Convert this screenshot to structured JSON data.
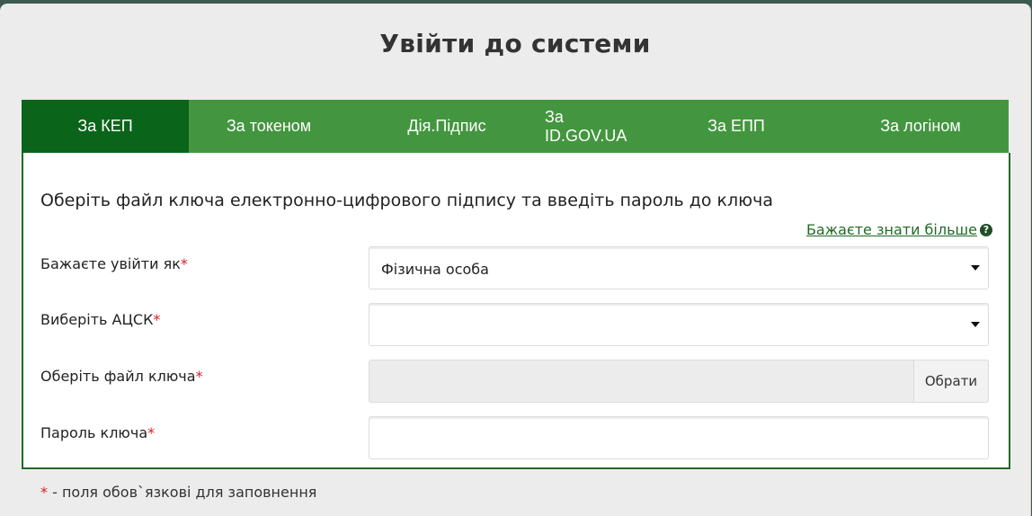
{
  "page": {
    "title": "Увійти до системи"
  },
  "tabs": [
    {
      "label": "За КЕП",
      "active": true
    },
    {
      "label": "За токеном",
      "active": false
    },
    {
      "label": "Дія.Підпис",
      "active": false
    },
    {
      "label": "За ID.GOV.UA",
      "active": false
    },
    {
      "label": "За ЕПП",
      "active": false
    },
    {
      "label": "За логіном",
      "active": false
    }
  ],
  "form": {
    "heading": "Оберіть файл ключа електронно-цифрового підпису та введіть пароль до ключа",
    "learn_more": "Бажаєте знати більше",
    "learn_more_icon": "question-circle-icon",
    "required_mark": "*",
    "login_as": {
      "label": "Бажаєте увійти як",
      "value": "Фізична особа"
    },
    "acsk": {
      "label": "Виберіть АЦСК",
      "value": ""
    },
    "key_file": {
      "label": "Оберіть файл ключа",
      "value": "",
      "button": "Обрати"
    },
    "password": {
      "label": "Пароль ключа",
      "value": ""
    }
  },
  "footnote": {
    "mark": "*",
    "text": " - поля обов`язкові для заповнення"
  },
  "colors": {
    "tab_bar": "#43963f",
    "tab_active": "#0a6419",
    "border_green": "#1f6b25",
    "required": "#d61f1f"
  }
}
